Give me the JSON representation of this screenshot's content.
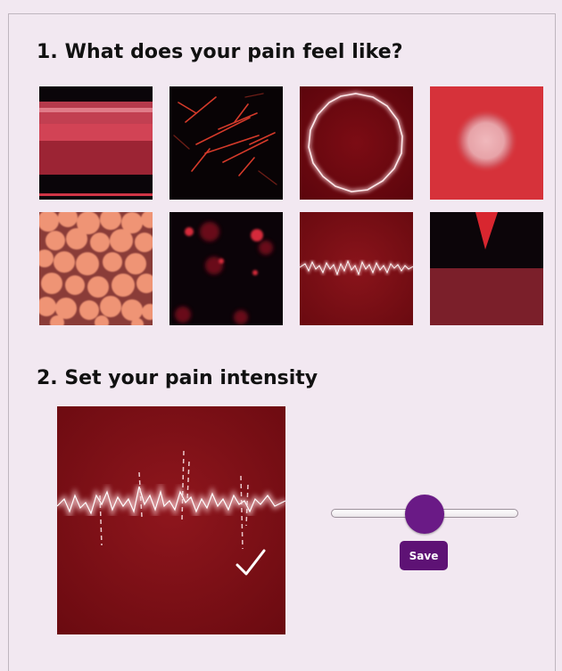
{
  "section1": {
    "title": "1. What does your pain feel like?"
  },
  "section2": {
    "title": "2. Set your pain intensity"
  },
  "pain_types": [
    {
      "icon": "stripes-pain-icon"
    },
    {
      "icon": "shooting-lines-pain-icon"
    },
    {
      "icon": "ring-pain-icon"
    },
    {
      "icon": "pressure-spot-pain-icon"
    },
    {
      "icon": "bubbles-pain-icon"
    },
    {
      "icon": "dots-pain-icon"
    },
    {
      "icon": "zigzag-pain-icon"
    },
    {
      "icon": "stab-pain-icon"
    }
  ],
  "intensity": {
    "slider_value": 0.5
  },
  "save_button": {
    "label": "Save"
  },
  "colors": {
    "accent": "#6a1a86",
    "button": "#5e1275",
    "background": "#f2e8f1"
  }
}
